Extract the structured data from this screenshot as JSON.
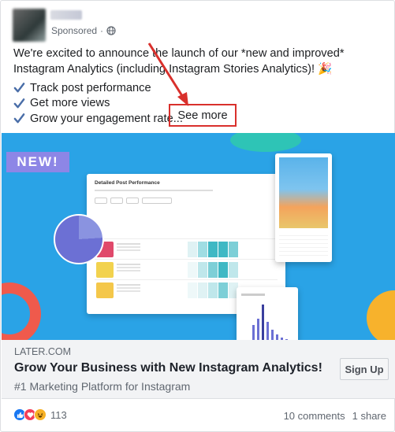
{
  "header": {
    "sponsored_label": "Sponsored",
    "separator": "·",
    "privacy_icon": "globe-icon"
  },
  "message": {
    "text": "We're excited to announce the launch of our *new and improved* Instagram Analytics (including Instagram Stories Analytics)! 🎉",
    "bullets": [
      "Track post performance",
      "Get more views",
      "Grow your engagement rate..."
    ],
    "see_more": "See more"
  },
  "hero": {
    "badge": "NEW!",
    "dashboard_title": "Detailed Post Performance"
  },
  "link_preview": {
    "domain": "LATER.COM",
    "title": "Grow Your Business with New Instagram Analytics!",
    "description": "#1 Marketing Platform for Instagram",
    "cta": "Sign Up"
  },
  "footer": {
    "reaction_count": "113",
    "comments": "10 comments",
    "shares": "1 share"
  },
  "colors": {
    "accent_blue": "#1877f2",
    "hero_background": "#2aa3e6",
    "annotation_red": "#d9302c"
  }
}
